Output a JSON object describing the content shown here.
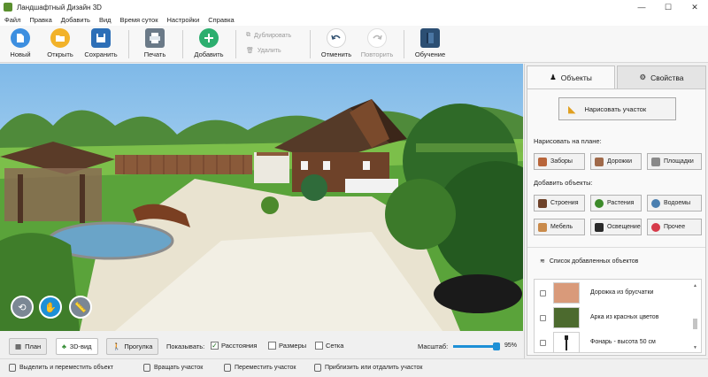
{
  "window": {
    "title": "Ландшафтный Дизайн 3D",
    "controls": [
      "—",
      "☐",
      "✕"
    ]
  },
  "menu": [
    "Файл",
    "Правка",
    "Добавить",
    "Вид",
    "Время суток",
    "Настройки",
    "Справка"
  ],
  "toolbar": {
    "new": "Новый",
    "open": "Открыть",
    "save": "Сохранить",
    "print": "Печать",
    "add": "Добавить",
    "duplicate": "Дублировать",
    "delete": "Удалить",
    "undo": "Отменить",
    "redo": "Повторить",
    "learn": "Обучение"
  },
  "panel": {
    "tab_objects": "Объекты",
    "tab_properties": "Свойства",
    "draw_area": "Нарисовать участок",
    "draw_on_plan": "Нарисовать на плане:",
    "draw_items": [
      "Заборы",
      "Дорожки",
      "Площадки"
    ],
    "add_objects": "Добавить объекты:",
    "object_items": [
      "Строения",
      "Растения",
      "Водоемы",
      "Мебель",
      "Освещение",
      "Прочее"
    ],
    "list_title": "Список добавленных объектов",
    "list_items": [
      "Дорожка из брусчатки",
      "Арка из красных цветов",
      "Фонарь - высота 50 см"
    ]
  },
  "bottom": {
    "plan": "План",
    "view3d": "3D-вид",
    "walk": "Прогулка",
    "show": "Показывать:",
    "distances": "Расстояния",
    "sizes": "Размеры",
    "grid": "Сетка",
    "scale_label": "Масштаб:",
    "scale_value": "95%",
    "scale_fraction": 0.95
  },
  "status": {
    "select_move": "Выделить и переместить объект",
    "rotate": "Вращать участок",
    "move": "Переместить участок",
    "zoom": "Приблизить или отдалить участок"
  },
  "colors": {
    "accent": "#1e90d6",
    "add_green": "#2cae6e",
    "toolbar_save": "#2d6fb7"
  }
}
